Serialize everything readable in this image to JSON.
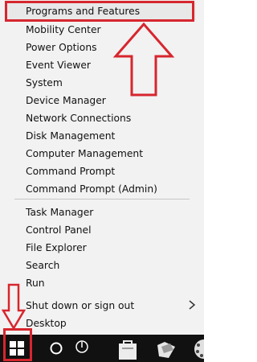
{
  "menu": {
    "items": [
      {
        "label": "Programs and Features"
      },
      {
        "label": "Mobility Center"
      },
      {
        "label": "Power Options"
      },
      {
        "label": "Event Viewer"
      },
      {
        "label": "System"
      },
      {
        "label": "Device Manager"
      },
      {
        "label": "Network Connections"
      },
      {
        "label": "Disk Management"
      },
      {
        "label": "Computer Management"
      },
      {
        "label": "Command Prompt"
      },
      {
        "label": "Command Prompt (Admin)"
      },
      {
        "label": "Task Manager"
      },
      {
        "label": "Control Panel"
      },
      {
        "label": "File Explorer"
      },
      {
        "label": "Search"
      },
      {
        "label": "Run"
      },
      {
        "label": "Shut down or sign out",
        "submenu_icon": "chevron-right-icon"
      },
      {
        "label": "Desktop"
      }
    ]
  },
  "annotations": {
    "color": "#d7262e",
    "highlight": "Programs and Features"
  },
  "taskbar": {
    "background": "#111111",
    "icons": [
      "windows-logo-icon",
      "cortana-search-icon",
      "power-icon",
      "store-icon",
      "folder-icon",
      "color-wheel-icon"
    ]
  }
}
